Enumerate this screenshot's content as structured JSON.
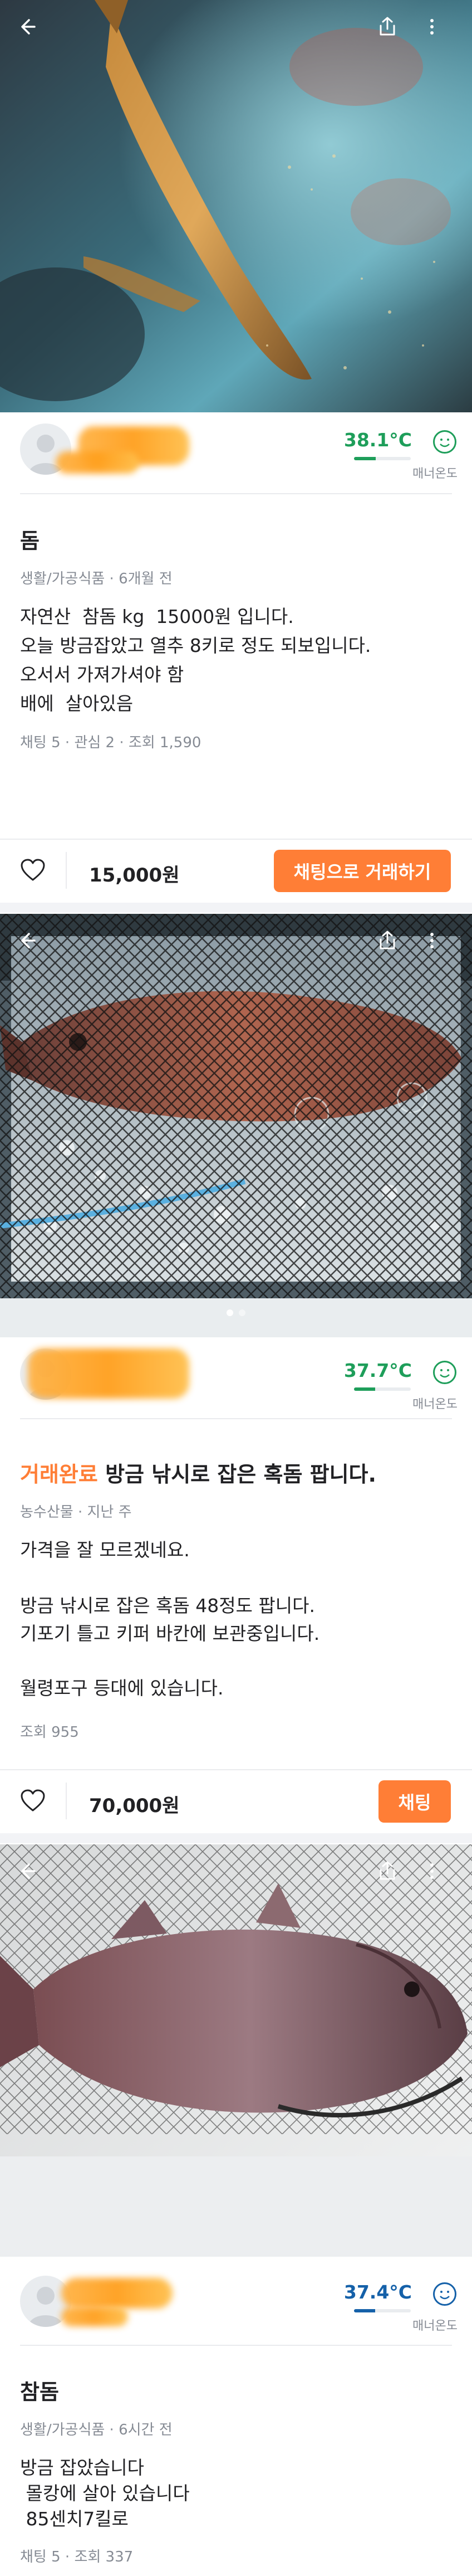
{
  "listings": [
    {
      "temperature": "38.1°C",
      "temperature_fill": 0.381,
      "manner_label": "매너온도",
      "title": "돔",
      "meta": "생활/가공식품 · 6개월 전",
      "description": [
        "자연산  참돔 kg  15000원 입니다.",
        "오늘 방금잡았고 열추 8키로 정도 되보입니다.",
        "오서서 가져가셔야 함",
        "배에  살아있음"
      ],
      "stats": "채팅 5 · 관심 2 · 조회 1,590",
      "price": "15,000원",
      "cta": "채팅으로 거래하기"
    },
    {
      "temperature": "37.7°C",
      "temperature_fill": 0.377,
      "manner_label": "매너온도",
      "status": "거래완료",
      "title": "방금 낚시로 잡은 혹돔 팝니다.",
      "meta": "농수산물 · 지난 주",
      "description": [
        "가격을 잘 모르겠네요.",
        "",
        "방금 낚시로 잡은 혹돔 48정도 팝니다.",
        "기포기 틀고 키퍼 바칸에 보관중입니다.",
        "",
        "월령포구 등대에 있습니다."
      ],
      "stats": "조회 955",
      "price": "70,000원",
      "cta": "채팅"
    },
    {
      "temperature": "37.4°C",
      "temperature_fill": 0.374,
      "manner_label": "매너온도",
      "title": "참돔",
      "meta": "생활/가공식품 · 6시간 전",
      "description": [
        "방금 잡았습니다",
        " 몰캉에 살아 있습니다",
        " 85센치7킬로"
      ],
      "stats": "채팅 5 · 조회 337"
    }
  ],
  "icons": {
    "back": "back-arrow-icon",
    "share": "share-icon",
    "more": "more-vertical-icon",
    "heart": "heart-outline-icon",
    "face": "smile-face-icon"
  },
  "colors": {
    "brand": "#ff7e36",
    "temp_green": "#1e9e5a",
    "temp_blue": "#1561a9",
    "text": "#212124",
    "muted": "#868b94"
  }
}
